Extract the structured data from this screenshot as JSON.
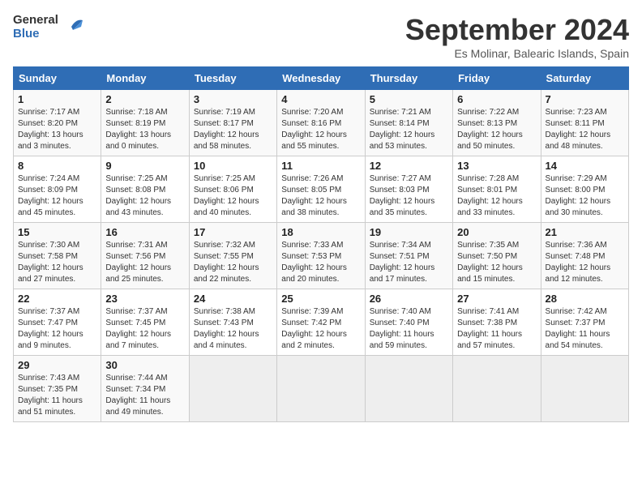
{
  "header": {
    "logo_line1": "General",
    "logo_line2": "Blue",
    "month": "September 2024",
    "location": "Es Molinar, Balearic Islands, Spain"
  },
  "columns": [
    "Sunday",
    "Monday",
    "Tuesday",
    "Wednesday",
    "Thursday",
    "Friday",
    "Saturday"
  ],
  "weeks": [
    [
      {
        "day": "1",
        "lines": [
          "Sunrise: 7:17 AM",
          "Sunset: 8:20 PM",
          "Daylight: 13 hours",
          "and 3 minutes."
        ]
      },
      {
        "day": "2",
        "lines": [
          "Sunrise: 7:18 AM",
          "Sunset: 8:19 PM",
          "Daylight: 13 hours",
          "and 0 minutes."
        ]
      },
      {
        "day": "3",
        "lines": [
          "Sunrise: 7:19 AM",
          "Sunset: 8:17 PM",
          "Daylight: 12 hours",
          "and 58 minutes."
        ]
      },
      {
        "day": "4",
        "lines": [
          "Sunrise: 7:20 AM",
          "Sunset: 8:16 PM",
          "Daylight: 12 hours",
          "and 55 minutes."
        ]
      },
      {
        "day": "5",
        "lines": [
          "Sunrise: 7:21 AM",
          "Sunset: 8:14 PM",
          "Daylight: 12 hours",
          "and 53 minutes."
        ]
      },
      {
        "day": "6",
        "lines": [
          "Sunrise: 7:22 AM",
          "Sunset: 8:13 PM",
          "Daylight: 12 hours",
          "and 50 minutes."
        ]
      },
      {
        "day": "7",
        "lines": [
          "Sunrise: 7:23 AM",
          "Sunset: 8:11 PM",
          "Daylight: 12 hours",
          "and 48 minutes."
        ]
      }
    ],
    [
      {
        "day": "8",
        "lines": [
          "Sunrise: 7:24 AM",
          "Sunset: 8:09 PM",
          "Daylight: 12 hours",
          "and 45 minutes."
        ]
      },
      {
        "day": "9",
        "lines": [
          "Sunrise: 7:25 AM",
          "Sunset: 8:08 PM",
          "Daylight: 12 hours",
          "and 43 minutes."
        ]
      },
      {
        "day": "10",
        "lines": [
          "Sunrise: 7:25 AM",
          "Sunset: 8:06 PM",
          "Daylight: 12 hours",
          "and 40 minutes."
        ]
      },
      {
        "day": "11",
        "lines": [
          "Sunrise: 7:26 AM",
          "Sunset: 8:05 PM",
          "Daylight: 12 hours",
          "and 38 minutes."
        ]
      },
      {
        "day": "12",
        "lines": [
          "Sunrise: 7:27 AM",
          "Sunset: 8:03 PM",
          "Daylight: 12 hours",
          "and 35 minutes."
        ]
      },
      {
        "day": "13",
        "lines": [
          "Sunrise: 7:28 AM",
          "Sunset: 8:01 PM",
          "Daylight: 12 hours",
          "and 33 minutes."
        ]
      },
      {
        "day": "14",
        "lines": [
          "Sunrise: 7:29 AM",
          "Sunset: 8:00 PM",
          "Daylight: 12 hours",
          "and 30 minutes."
        ]
      }
    ],
    [
      {
        "day": "15",
        "lines": [
          "Sunrise: 7:30 AM",
          "Sunset: 7:58 PM",
          "Daylight: 12 hours",
          "and 27 minutes."
        ]
      },
      {
        "day": "16",
        "lines": [
          "Sunrise: 7:31 AM",
          "Sunset: 7:56 PM",
          "Daylight: 12 hours",
          "and 25 minutes."
        ]
      },
      {
        "day": "17",
        "lines": [
          "Sunrise: 7:32 AM",
          "Sunset: 7:55 PM",
          "Daylight: 12 hours",
          "and 22 minutes."
        ]
      },
      {
        "day": "18",
        "lines": [
          "Sunrise: 7:33 AM",
          "Sunset: 7:53 PM",
          "Daylight: 12 hours",
          "and 20 minutes."
        ]
      },
      {
        "day": "19",
        "lines": [
          "Sunrise: 7:34 AM",
          "Sunset: 7:51 PM",
          "Daylight: 12 hours",
          "and 17 minutes."
        ]
      },
      {
        "day": "20",
        "lines": [
          "Sunrise: 7:35 AM",
          "Sunset: 7:50 PM",
          "Daylight: 12 hours",
          "and 15 minutes."
        ]
      },
      {
        "day": "21",
        "lines": [
          "Sunrise: 7:36 AM",
          "Sunset: 7:48 PM",
          "Daylight: 12 hours",
          "and 12 minutes."
        ]
      }
    ],
    [
      {
        "day": "22",
        "lines": [
          "Sunrise: 7:37 AM",
          "Sunset: 7:47 PM",
          "Daylight: 12 hours",
          "and 9 minutes."
        ]
      },
      {
        "day": "23",
        "lines": [
          "Sunrise: 7:37 AM",
          "Sunset: 7:45 PM",
          "Daylight: 12 hours",
          "and 7 minutes."
        ]
      },
      {
        "day": "24",
        "lines": [
          "Sunrise: 7:38 AM",
          "Sunset: 7:43 PM",
          "Daylight: 12 hours",
          "and 4 minutes."
        ]
      },
      {
        "day": "25",
        "lines": [
          "Sunrise: 7:39 AM",
          "Sunset: 7:42 PM",
          "Daylight: 12 hours",
          "and 2 minutes."
        ]
      },
      {
        "day": "26",
        "lines": [
          "Sunrise: 7:40 AM",
          "Sunset: 7:40 PM",
          "Daylight: 11 hours",
          "and 59 minutes."
        ]
      },
      {
        "day": "27",
        "lines": [
          "Sunrise: 7:41 AM",
          "Sunset: 7:38 PM",
          "Daylight: 11 hours",
          "and 57 minutes."
        ]
      },
      {
        "day": "28",
        "lines": [
          "Sunrise: 7:42 AM",
          "Sunset: 7:37 PM",
          "Daylight: 11 hours",
          "and 54 minutes."
        ]
      }
    ],
    [
      {
        "day": "29",
        "lines": [
          "Sunrise: 7:43 AM",
          "Sunset: 7:35 PM",
          "Daylight: 11 hours",
          "and 51 minutes."
        ]
      },
      {
        "day": "30",
        "lines": [
          "Sunrise: 7:44 AM",
          "Sunset: 7:34 PM",
          "Daylight: 11 hours",
          "and 49 minutes."
        ]
      },
      {
        "day": "",
        "lines": []
      },
      {
        "day": "",
        "lines": []
      },
      {
        "day": "",
        "lines": []
      },
      {
        "day": "",
        "lines": []
      },
      {
        "day": "",
        "lines": []
      }
    ]
  ]
}
